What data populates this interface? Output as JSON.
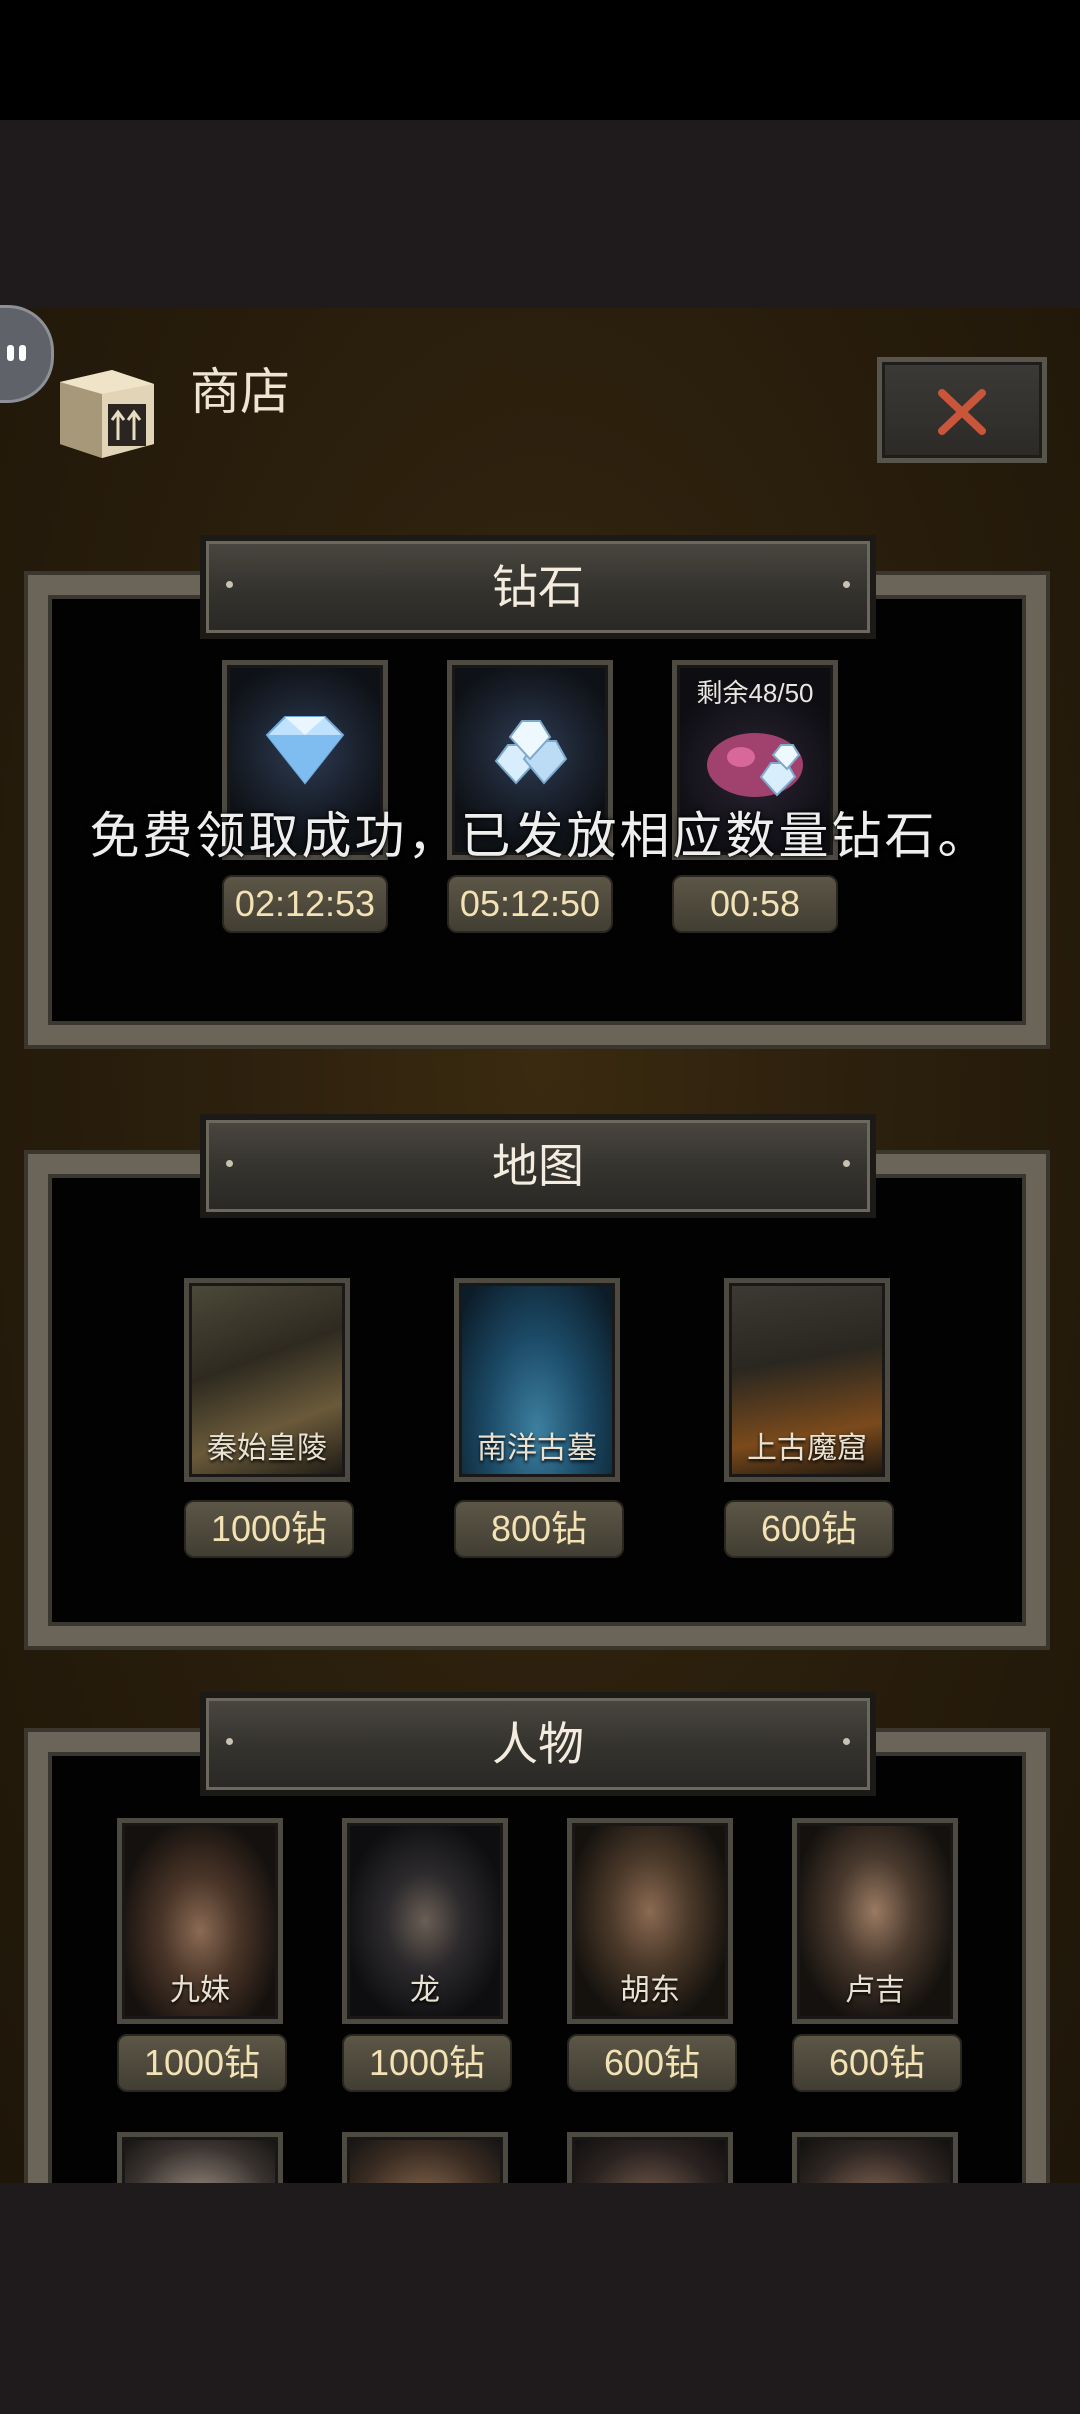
{
  "colors": {
    "panel_frame": "#6a6558",
    "pill_text": "#f3e2b4",
    "accent_close": "#c9553a"
  },
  "header": {
    "title": "商店",
    "shop_icon": "box-up-arrow-icon",
    "close_icon": "close-x-icon"
  },
  "diamond_section": {
    "title": "钻石",
    "items": [
      {
        "icon": "diamond-icon",
        "timer": "02:12:53"
      },
      {
        "icon": "diamond-pile-icon",
        "timer": "05:12:50"
      },
      {
        "icon": "diamond-bag-icon",
        "remaining": "剩余48/50",
        "timer": "00:58"
      }
    ]
  },
  "map_section": {
    "title": "地图",
    "items": [
      {
        "name": "秦始皇陵",
        "price": "1000钻"
      },
      {
        "name": "南洋古墓",
        "price": "800钻"
      },
      {
        "name": "上古魔窟",
        "price": "600钻"
      }
    ]
  },
  "character_section": {
    "title": "人物",
    "items": [
      {
        "name": "九妹",
        "price": "1000钻"
      },
      {
        "name": "龙",
        "price": "1000钻"
      },
      {
        "name": "胡东",
        "price": "600钻"
      },
      {
        "name": "卢吉",
        "price": "600钻"
      }
    ]
  },
  "toast": "免费领取成功，已发放相应数量钻石。"
}
